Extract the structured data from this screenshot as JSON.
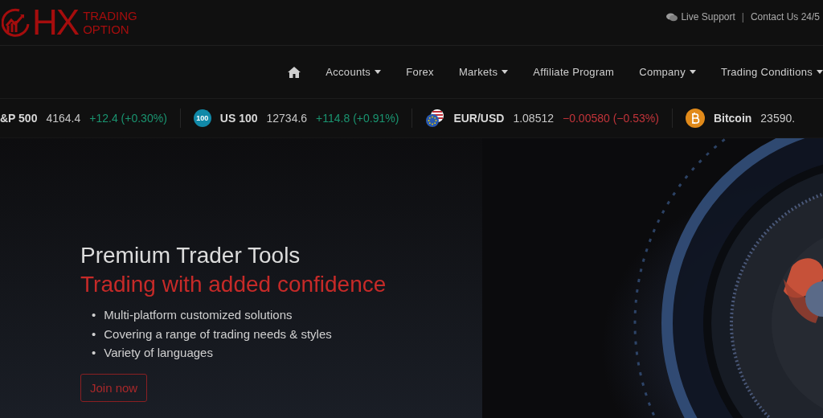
{
  "brand": {
    "mark": "HX",
    "line_1": "TRADING",
    "line_2": "OPTION"
  },
  "top_links": [
    {
      "label": "Live Support",
      "kind": "chat"
    },
    {
      "label": "Contact Us 24/5",
      "kind": "plain"
    }
  ],
  "top_separator": "|",
  "nav": [
    {
      "kind": "home",
      "dropdown": false
    },
    {
      "label": "Accounts",
      "kind": "text",
      "dropdown": true
    },
    {
      "label": "Forex",
      "kind": "text",
      "dropdown": false
    },
    {
      "label": "Markets",
      "kind": "text",
      "dropdown": true
    },
    {
      "label": "Affiliate Program",
      "kind": "text",
      "dropdown": false
    },
    {
      "label": "Company",
      "kind": "text",
      "dropdown": true
    },
    {
      "label": "Trading Conditions",
      "kind": "text",
      "dropdown": true
    }
  ],
  "ticker": [
    {
      "kind": "none",
      "name": "&P 500",
      "price": "4164.4",
      "change": "+12.4 (+0.30%)",
      "color": "#1a9470"
    },
    {
      "kind": "index",
      "badge": "100",
      "name": "US 100",
      "price": "12734.6",
      "change": "+114.8 (+0.91%)",
      "color": "#1a9470"
    },
    {
      "kind": "forex",
      "name": "EUR/USD",
      "price": "1.08512",
      "change": "−0.00580 (−0.53%)",
      "color": "#c2343a"
    },
    {
      "kind": "crypto",
      "name": "Bitcoin",
      "price": "23590."
    }
  ],
  "hero": {
    "marker": "•",
    "title": "Premium Trader Tools",
    "subtitle": "Trading with added confidence",
    "bullets": [
      "Multi-platform customized solutions",
      "Covering a range of trading needs & styles",
      "Variety of languages"
    ],
    "button": "Join now"
  }
}
